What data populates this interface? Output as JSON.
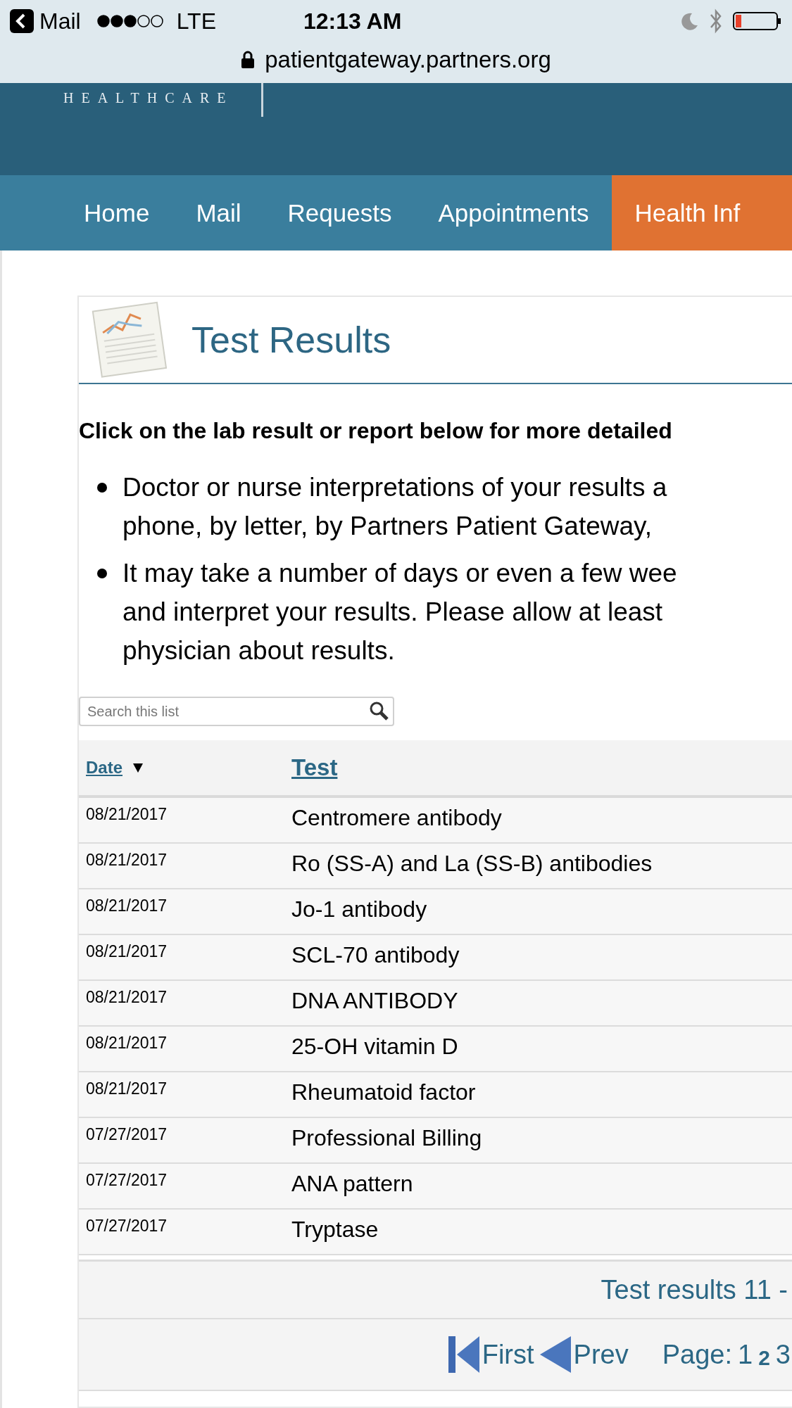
{
  "status_bar": {
    "back_label": "Mail",
    "carrier": "LTE",
    "time": "12:13 AM",
    "url": "patientgateway.partners.org"
  },
  "header": {
    "logo_text": "HEALTHCARE"
  },
  "nav": [
    {
      "label": "Home",
      "selected": false
    },
    {
      "label": "Mail",
      "selected": false
    },
    {
      "label": "Requests",
      "selected": false
    },
    {
      "label": "Appointments",
      "selected": false
    },
    {
      "label": "Health Inf",
      "selected": true
    }
  ],
  "card": {
    "title": "Test Results",
    "intro": "Click on the lab result or report below for more detailed",
    "bullets": [
      "Doctor or nurse interpretations of your results a\nphone, by letter, by Partners Patient Gateway,",
      "It may take a number of days or even a few wee\nand interpret your results. Please allow at least\nphysician about results."
    ],
    "search": {
      "placeholder": "Search this list"
    }
  },
  "table": {
    "columns": [
      {
        "label": "Date",
        "sorted": true
      },
      {
        "label": "Test",
        "sorted": false
      }
    ],
    "rows": [
      {
        "date": "08/21/2017",
        "test": "Centromere antibody"
      },
      {
        "date": "08/21/2017",
        "test": "Ro (SS-A) and La (SS-B) antibodies"
      },
      {
        "date": "08/21/2017",
        "test": "Jo-1 antibody"
      },
      {
        "date": "08/21/2017",
        "test": "SCL-70 antibody"
      },
      {
        "date": "08/21/2017",
        "test": "DNA ANTIBODY"
      },
      {
        "date": "08/21/2017",
        "test": "25-OH vitamin D"
      },
      {
        "date": "08/21/2017",
        "test": "Rheumatoid factor"
      },
      {
        "date": "07/27/2017",
        "test": "Professional Billing"
      },
      {
        "date": "07/27/2017",
        "test": "ANA pattern"
      },
      {
        "date": "07/27/2017",
        "test": "Tryptase"
      }
    ]
  },
  "results_count": "Test results 11 -",
  "pagination": {
    "first": "First",
    "prev": "Prev",
    "page_label": "Page:",
    "pages": [
      {
        "label": "1",
        "selected": false
      },
      {
        "label": "2",
        "selected": true
      },
      {
        "label": "3",
        "selected": false
      }
    ]
  }
}
